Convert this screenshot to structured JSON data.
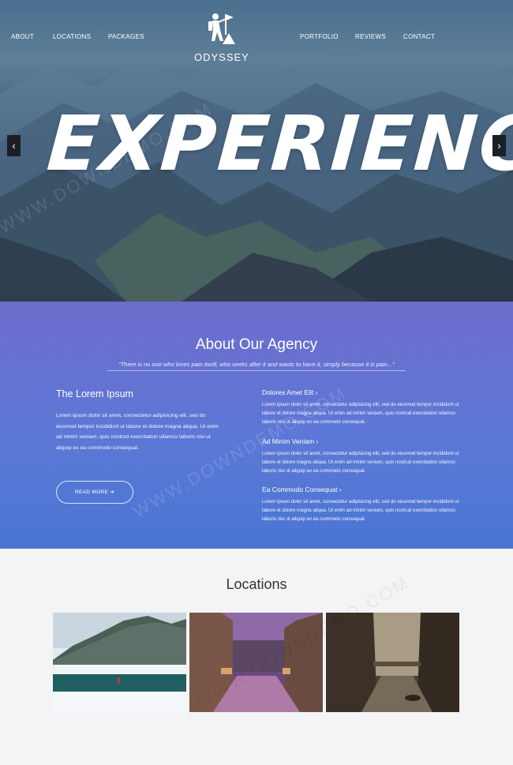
{
  "nav": {
    "left": [
      "ABOUT",
      "LOCATIONS",
      "PACKAGES"
    ],
    "right": [
      "PORTFOLIO",
      "REVIEWS",
      "CONTACT"
    ]
  },
  "logo": {
    "name": "ODYSSEY",
    "icon": "hiker-flag-icon"
  },
  "hero": {
    "headline": "EXPERIENCE",
    "prev": "‹",
    "next": "›"
  },
  "about": {
    "title": "About Our Agency",
    "quote": "\"There is no one who loves pain itself, who seeks after it and wants to have it, simply because it is pain...\"",
    "left": {
      "title": "The Lorem Ipsum",
      "text": "Lorem ipsum dolor sit amet, consectetur adipisicing elit, sed do eiusmod tempor incididunt ut labore et dolore magna aliqua. Ut enim ad minim veniam, quis nostrud exercitation ullamco laboris nisi ut aliquip ex ea commodo consequat.",
      "button": "READ MORE ➔"
    },
    "features": [
      {
        "title": "Dolores Amet Elit ›",
        "text": "Lorem ipsum dolor sit amet, consectetur adipisicing elit, sed do eiusmod tempor incididunt ut labore et dolore magna aliqua. Ut enim ad minim veniam, quis nostrud exercitation ullamco laboris nisi ut aliquip ex ea commodo consequat."
      },
      {
        "title": "Ad Minim Veniam ›",
        "text": "Lorem ipsum dolor sit amet, consectetur adipisicing elit, sed do eiusmod tempor incididunt ut labore et dolore magna aliqua. Ut enim ad minim veniam, quis nostrud exercitation ullamco laboris nisi ut aliquip ex ea commodo consequat."
      },
      {
        "title": "Ea Commodo Consequat ›",
        "text": "Lorem ipsum dolor sit amet, consectetur adipisicing elit, sed do eiusmod tempor incididunt ut labore et dolore magna aliqua. Ut enim ad minim veniam, quis nostrud exercitation ullamco laboris nisi ut aliquip ex ea commodo consequat."
      }
    ]
  },
  "locations": {
    "title": "Locations"
  },
  "watermark": "WWW.DOWNDEMO.COM",
  "colors": {
    "about_top": "#6e6ccc",
    "about_bottom": "#4a76d3",
    "page_bg": "#f4f4f6"
  }
}
